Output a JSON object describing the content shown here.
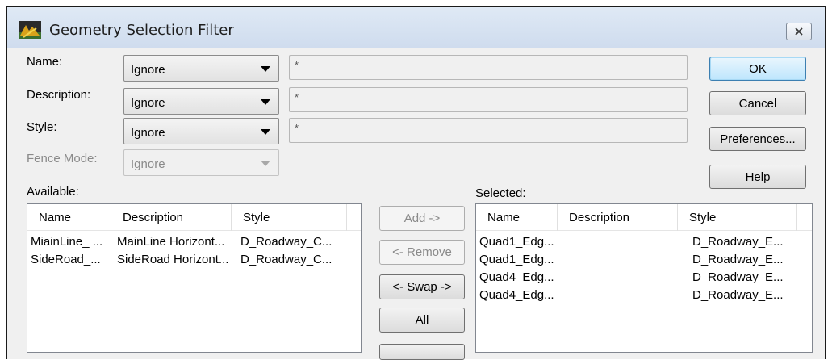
{
  "window": {
    "title": "Geometry Selection Filter",
    "close_icon": "close-icon"
  },
  "fields": {
    "name": {
      "label": "Name:",
      "mode": "Ignore",
      "value": "*"
    },
    "description": {
      "label": "Description:",
      "mode": "Ignore",
      "value": "*"
    },
    "style": {
      "label": "Style:",
      "mode": "Ignore",
      "value": "*"
    },
    "fence_mode": {
      "label": "Fence Mode:",
      "mode": "Ignore"
    }
  },
  "buttons": {
    "ok": "OK",
    "cancel": "Cancel",
    "preferences": "Preferences...",
    "help": "Help",
    "add": "Add ->",
    "remove": "<- Remove",
    "swap": "<- Swap ->",
    "all": "All"
  },
  "available": {
    "label": "Available:",
    "columns": [
      "Name",
      "Description",
      "Style"
    ],
    "rows": [
      [
        "MiainLine_ ...",
        "MainLine Horizont...",
        "D_Roadway_C..."
      ],
      [
        "SideRoad_...",
        "SideRoad Horizont...",
        "D_Roadway_C..."
      ]
    ]
  },
  "selected": {
    "label": "Selected:",
    "columns": [
      "Name",
      "Description",
      "Style"
    ],
    "rows": [
      [
        "Quad1_Edg...",
        "",
        "D_Roadway_E..."
      ],
      [
        "Quad1_Edg...",
        "",
        "D_Roadway_E..."
      ],
      [
        "Quad4_Edg...",
        "",
        "D_Roadway_E..."
      ],
      [
        "Quad4_Edg...",
        "",
        "D_Roadway_E..."
      ]
    ]
  }
}
